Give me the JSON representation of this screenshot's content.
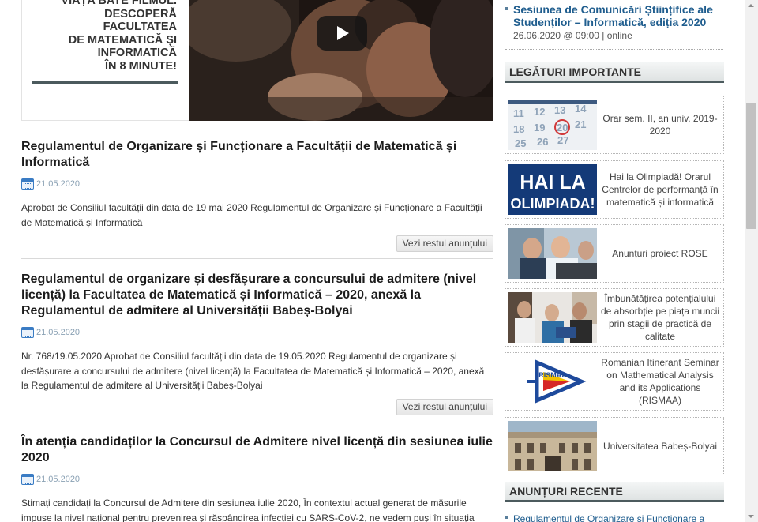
{
  "promo": {
    "lines": [
      "Viața bate filmul.",
      "Descoperă",
      "Facultatea",
      "de Matematică și",
      "Informatică",
      "în 8 minute!"
    ]
  },
  "articles": [
    {
      "title": "Regulamentul de Organizare și Funcționare a Facultății de Matematică și Informatică",
      "date": "21.05.2020",
      "excerpt": "Aprobat de Consiliul facultății din data de 19 mai 2020 Regulamentul de Organizare și Funcționare a Facultății de Matematică și Informatică",
      "more": "Vezi restul anunțului"
    },
    {
      "title": "Regulamentul de organizare și desfășurare a concursului de admitere (nivel licență) la Facultatea de Matematică și Informatică – 2020, anexă la Regulamentul de admitere al Universității Babeș-Bolyai",
      "date": "21.05.2020",
      "excerpt": "Nr. 768/19.05.2020 Aprobat de Consiliul facultății din data de 19.05.2020 Regulamentul de organizare și desfășurare a concursului de admitere (nivel licență) la Facultatea de Matematică și Informatică – 2020, anexă la Regulamentul de admitere al Universității Babeș-Bolyai",
      "more": "Vezi restul anunțului"
    },
    {
      "title": "În atenția candidaților la Concursul de Admitere nivel licență din sesiunea iulie 2020",
      "date": "21.05.2020",
      "excerpt": "Stimați candidați la Concursul de Admitere din sesiunea iulie 2020, În contextul actual generat de măsurile impuse la nivel național pentru prevenirea și răspândirea infecției cu SARS-CoV-2, ne vedem puși în situația"
    }
  ],
  "sidebar": {
    "event": {
      "title": "Sesiunea de Comunicări Științifice ale Studenților – Informatică, ediția 2020",
      "meta": "26.06.2020 @ 09:00 | online"
    },
    "links_heading": "LEGĂTURI IMPORTANTE",
    "links": [
      {
        "label": "Orar sem. II, an univ. 2019-2020",
        "icon": "calendar-thumbnail"
      },
      {
        "label": "Hai la Olimpiadă! Orarul Centrelor de performanță în matematică și informatică",
        "icon": "olympiad-banner",
        "banner_lines": [
          "HAI LA",
          "OLIMPIADA!"
        ]
      },
      {
        "label": "Anunțuri proiect ROSE",
        "icon": "students-photo"
      },
      {
        "label": "Îmbunătățirea potențialului de absorbție pe piața muncii prin stagii de practică de calitate",
        "icon": "practice-photo"
      },
      {
        "label": "Romanian Itinerant Seminar on Mathematical Analysis and its Applications (RISMAA)",
        "icon": "rismaa-logo",
        "logo_text": "RISMAA"
      },
      {
        "label": "Universitatea Babeș-Bolyai",
        "icon": "university-building"
      }
    ],
    "recent_heading": "ANUNȚURI RECENTE",
    "recent": [
      "Regulamentul de Organizare și Funcționare a"
    ]
  },
  "colors": {
    "link_blue": "#1f5d8e",
    "heading_bar": "#4c5b5e",
    "date_grey": "#8aa1b4"
  }
}
